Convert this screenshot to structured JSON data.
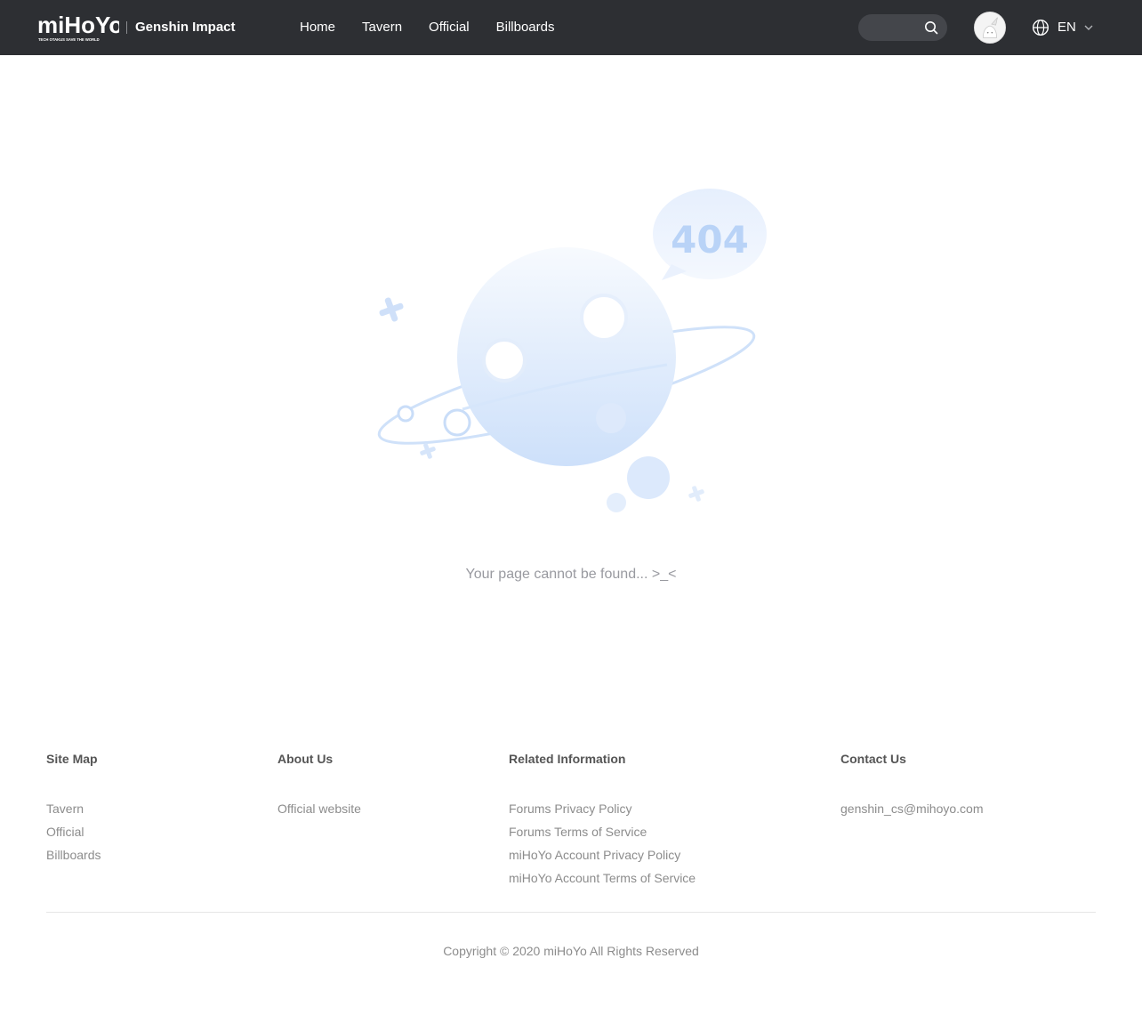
{
  "header": {
    "logo_text": "miHoYo",
    "logo_tagline": "TECH OTAKUS SAVE THE WORLD",
    "brand": "Genshin Impact",
    "nav": [
      {
        "label": "Home"
      },
      {
        "label": "Tavern"
      },
      {
        "label": "Official"
      },
      {
        "label": "Billboards"
      }
    ],
    "search": {
      "placeholder": "",
      "icon": "search-icon"
    },
    "language": {
      "label": "EN",
      "icon": "globe-icon"
    }
  },
  "main": {
    "illustration_text": "404",
    "message": "Your page cannot be found... >_<"
  },
  "footer": {
    "columns": [
      {
        "title": "Site Map",
        "links": [
          "Tavern",
          "Official",
          "Billboards"
        ]
      },
      {
        "title": "About Us",
        "links": [
          "Official website"
        ]
      },
      {
        "title": "Related Information",
        "links": [
          "Forums Privacy Policy",
          "Forums Terms of Service",
          "miHoYo Account Privacy Policy",
          "miHoYo Account Terms of Service"
        ]
      },
      {
        "title": "Contact Us",
        "links": [
          "genshin_cs@mihoyo.com"
        ]
      }
    ],
    "copyright": "Copyright © 2020 miHoYo All Rights Reserved"
  },
  "colors": {
    "header_bg": "#2d2f33",
    "illustration_blue": "#cfe2fb",
    "text_muted": "#8c8c8c"
  }
}
